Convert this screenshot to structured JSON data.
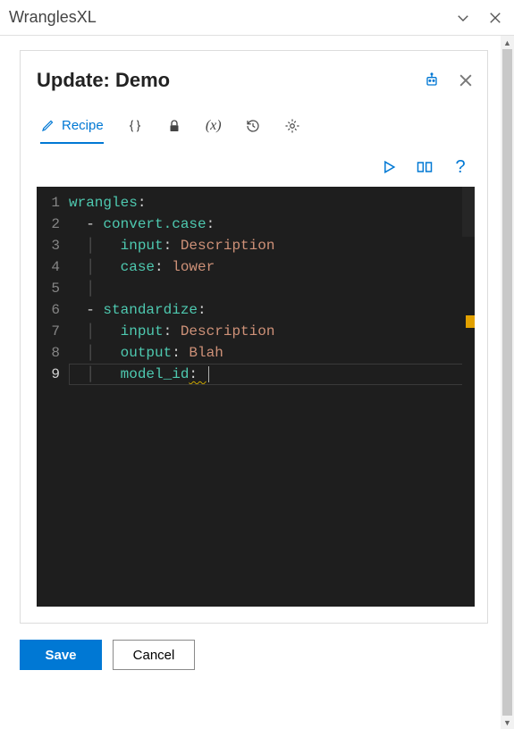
{
  "pane": {
    "title": "WranglesXL"
  },
  "header": {
    "title": "Update: Demo"
  },
  "tabs": {
    "recipe": "Recipe"
  },
  "buttons": {
    "save": "Save",
    "cancel": "Cancel"
  },
  "editor": {
    "line_numbers": [
      "1",
      "2",
      "3",
      "4",
      "5",
      "6",
      "7",
      "8",
      "9"
    ],
    "lines": [
      [
        {
          "c": "tk-k",
          "t": "wrangles"
        },
        {
          "c": "tk-p",
          "t": ":"
        }
      ],
      [
        {
          "c": "tk-g",
          "t": "  "
        },
        {
          "c": "tk-p",
          "t": "- "
        },
        {
          "c": "tk-k",
          "t": "convert.case"
        },
        {
          "c": "tk-p",
          "t": ":"
        }
      ],
      [
        {
          "c": "tk-g",
          "t": "  │   "
        },
        {
          "c": "tk-k",
          "t": "input"
        },
        {
          "c": "tk-p",
          "t": ": "
        },
        {
          "c": "tk-v",
          "t": "Description"
        }
      ],
      [
        {
          "c": "tk-g",
          "t": "  │   "
        },
        {
          "c": "tk-k",
          "t": "case"
        },
        {
          "c": "tk-p",
          "t": ": "
        },
        {
          "c": "tk-v",
          "t": "lower"
        }
      ],
      [
        {
          "c": "tk-g",
          "t": "  │"
        }
      ],
      [
        {
          "c": "tk-g",
          "t": "  "
        },
        {
          "c": "tk-p",
          "t": "- "
        },
        {
          "c": "tk-k",
          "t": "standardize"
        },
        {
          "c": "tk-p",
          "t": ":"
        }
      ],
      [
        {
          "c": "tk-g",
          "t": "  │   "
        },
        {
          "c": "tk-k",
          "t": "input"
        },
        {
          "c": "tk-p",
          "t": ": "
        },
        {
          "c": "tk-v",
          "t": "Description"
        }
      ],
      [
        {
          "c": "tk-g",
          "t": "  │   "
        },
        {
          "c": "tk-k",
          "t": "output"
        },
        {
          "c": "tk-p",
          "t": ": "
        },
        {
          "c": "tk-v",
          "t": "Blah"
        }
      ],
      [
        {
          "c": "tk-g",
          "t": "  │   "
        },
        {
          "c": "tk-k",
          "t": "model_id"
        },
        {
          "c": "tk-p squiggle",
          "t": ": "
        }
      ]
    ],
    "current_line": 9
  }
}
